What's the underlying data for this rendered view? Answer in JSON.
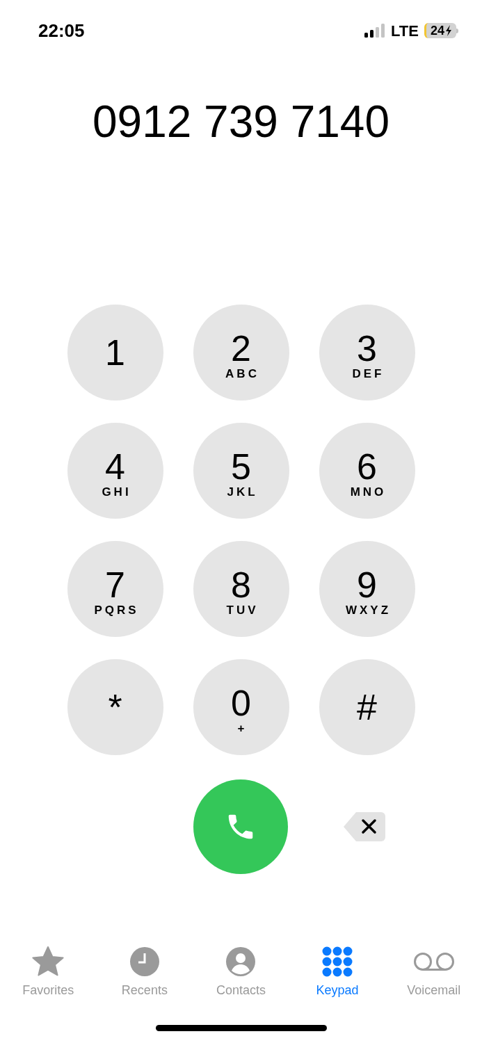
{
  "status_bar": {
    "time": "22:05",
    "network": "LTE",
    "battery": "24",
    "charging": true
  },
  "number": "0912 739 7140",
  "keys": [
    {
      "digit": "1"
    },
    {
      "digit": "2",
      "letters": "ABC"
    },
    {
      "digit": "3",
      "letters": "DEF"
    },
    {
      "digit": "4",
      "letters": "GHI"
    },
    {
      "digit": "5",
      "letters": "JKL"
    },
    {
      "digit": "6",
      "letters": "MNO"
    },
    {
      "digit": "7",
      "letters": "PQRS"
    },
    {
      "digit": "8",
      "letters": "TUV"
    },
    {
      "digit": "9",
      "letters": "WXYZ"
    },
    {
      "digit": "*"
    },
    {
      "digit": "0",
      "letters": "+"
    },
    {
      "digit": "#"
    }
  ],
  "tabs": [
    {
      "label": "Favorites",
      "kind": "star",
      "selected": false
    },
    {
      "label": "Recents",
      "kind": "clock",
      "selected": false
    },
    {
      "label": "Contacts",
      "kind": "person",
      "selected": false
    },
    {
      "label": "Keypad",
      "kind": "keypad",
      "selected": true
    },
    {
      "label": "Voicemail",
      "kind": "voicemail",
      "selected": false
    }
  ]
}
